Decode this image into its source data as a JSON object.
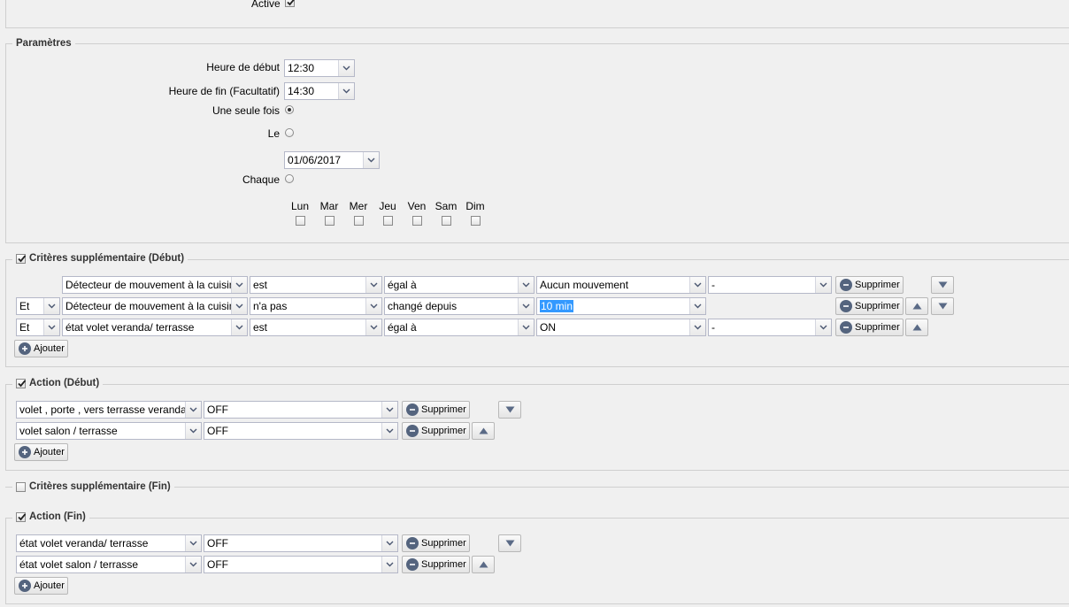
{
  "top": {
    "active_label": "Active",
    "active_checked": true
  },
  "params": {
    "legend": "Paramètres",
    "start_label": "Heure de début",
    "start_value": "12:30",
    "end_label": "Heure de fin (Facultatif)",
    "end_value": "14:30",
    "once_label": "Une seule fois",
    "on_label": "Le",
    "date_value": "01/06/2017",
    "every_label": "Chaque",
    "days": [
      "Lun",
      "Mar",
      "Mer",
      "Jeu",
      "Ven",
      "Sam",
      "Dim"
    ]
  },
  "crit_start": {
    "legend": "Critères supplémentaire (Début)",
    "checked": true,
    "rows": [
      {
        "logic": "",
        "device": "Détecteur de mouvement à la cuisine",
        "op": "est",
        "cmp": "égal à",
        "value": "Aucun mouvement",
        "extra": "-"
      },
      {
        "logic": "Et",
        "device": "Détecteur de mouvement à la cuisine",
        "op": "n'a pas",
        "cmp": "changé depuis",
        "value": "10 min",
        "extra": ""
      },
      {
        "logic": "Et",
        "device": "état volet veranda/ terrasse",
        "op": "est",
        "cmp": "égal à",
        "value": "ON",
        "extra": "-"
      }
    ],
    "delete_label": "Supprimer",
    "add_label": "Ajouter"
  },
  "action_start": {
    "legend": "Action (Début)",
    "checked": true,
    "rows": [
      {
        "device": "volet , porte , vers terrasse veranda",
        "value": "OFF"
      },
      {
        "device": "volet salon / terrasse",
        "value": "OFF"
      }
    ],
    "delete_label": "Supprimer",
    "add_label": "Ajouter"
  },
  "crit_end": {
    "legend": "Critères supplémentaire (Fin)",
    "checked": false
  },
  "action_end": {
    "legend": "Action (Fin)",
    "checked": true,
    "rows": [
      {
        "device": "état volet veranda/ terrasse",
        "value": "OFF"
      },
      {
        "device": "état volet salon / terrasse",
        "value": "OFF"
      }
    ],
    "delete_label": "Supprimer",
    "add_label": "Ajouter"
  },
  "icons": {
    "delete": "minus-circle-icon",
    "add": "plus-circle-icon",
    "up": "arrow-up-icon",
    "down": "arrow-down-icon",
    "trigger": "chevron-down-icon",
    "check": "checkmark-icon"
  }
}
